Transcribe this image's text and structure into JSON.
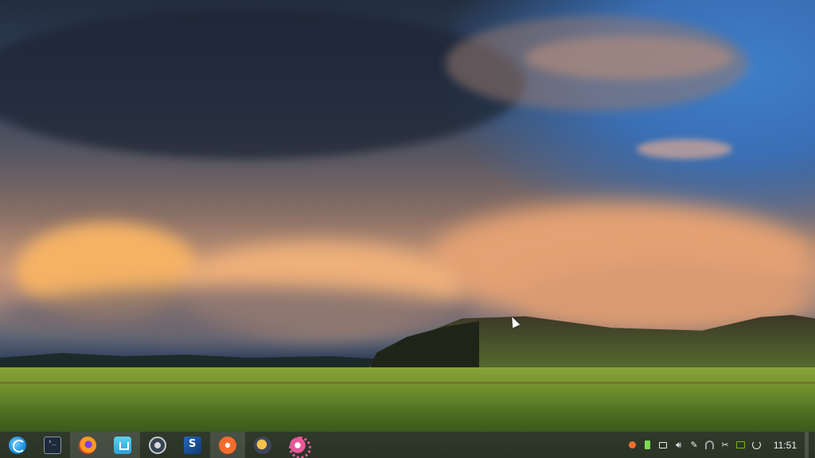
{
  "desktop": {
    "wallpaper": "sunset-clouds-over-grassland"
  },
  "taskbar": {
    "apps": [
      {
        "name": "launcher",
        "icon": "deepin-launcher-icon",
        "active": false
      },
      {
        "name": "terminal",
        "icon": "terminal-icon",
        "active": false
      },
      {
        "name": "firefox",
        "icon": "firefox-icon",
        "active": true
      },
      {
        "name": "app-store",
        "icon": "app-store-icon",
        "active": true
      },
      {
        "name": "steam",
        "icon": "steam-icon",
        "active": false
      },
      {
        "name": "ide",
        "icon": "ide-icon",
        "active": false
      },
      {
        "name": "origin",
        "icon": "origin-icon",
        "active": true
      },
      {
        "name": "fox-app",
        "icon": "fox-app-icon",
        "active": false
      },
      {
        "name": "settings",
        "icon": "settings-icon",
        "active": false
      }
    ],
    "tray": [
      "origin-tray-icon",
      "battery-icon",
      "notification-icon",
      "volume-icon",
      "pen-icon",
      "wifi-icon",
      "screenshot-icon",
      "nvidia-icon",
      "power-icon"
    ],
    "clock": "11:51"
  }
}
